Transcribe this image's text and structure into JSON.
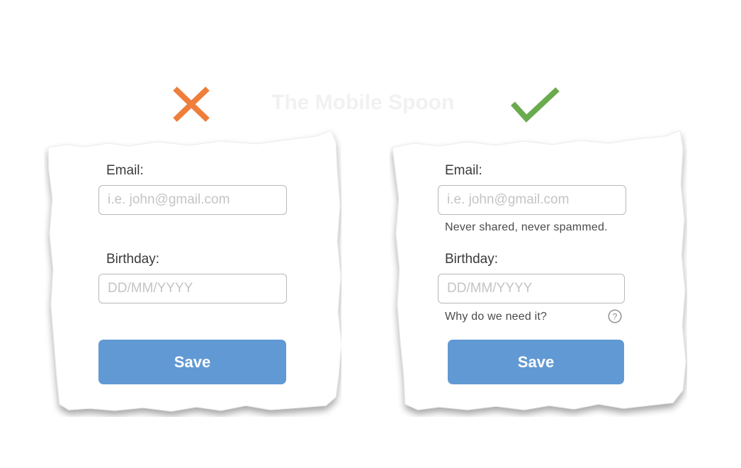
{
  "watermark": "The Mobile Spoon",
  "colors": {
    "bad_mark": "#ee7f3b",
    "good_mark": "#6aab4e",
    "button": "#6199d4",
    "button_text": "#ffffff"
  },
  "icons": {
    "bad": "x-mark-icon",
    "good": "check-mark-icon",
    "help": "question-circle-icon"
  },
  "bad_form": {
    "email_label": "Email:",
    "email_placeholder": "i.e. john@gmail.com",
    "birthday_label": "Birthday:",
    "birthday_placeholder": "DD/MM/YYYY",
    "save_label": "Save"
  },
  "good_form": {
    "email_label": "Email:",
    "email_placeholder": "i.e. john@gmail.com",
    "email_hint": "Never shared, never spammed.",
    "birthday_label": "Birthday:",
    "birthday_placeholder": "DD/MM/YYYY",
    "birthday_hint": "Why do we need it?",
    "save_label": "Save"
  }
}
